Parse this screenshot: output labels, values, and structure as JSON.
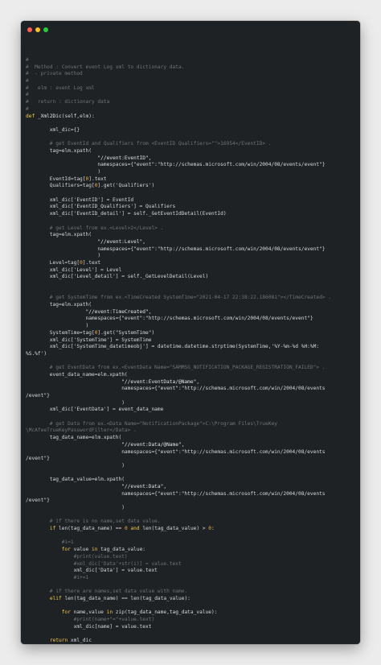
{
  "window": {
    "buttons": [
      {
        "name": "close",
        "color": "#ff5f56"
      },
      {
        "name": "minimize",
        "color": "#ffbd2e"
      },
      {
        "name": "zoom",
        "color": "#27c93f"
      }
    ]
  },
  "code": {
    "lines": [
      [
        [
          "c",
          "#"
        ]
      ],
      [
        [
          "c",
          "#  Method : Convert event Log xml to dictionary data."
        ]
      ],
      [
        [
          "c",
          "#  - private method"
        ]
      ],
      [
        [
          "c",
          "#"
        ]
      ],
      [
        [
          "c",
          "#   elm : event Log xml"
        ]
      ],
      [
        [
          "c",
          "#"
        ]
      ],
      [
        [
          "c",
          "#   return : dictionary data"
        ]
      ],
      [
        [
          "c",
          "#"
        ]
      ],
      [
        [
          "k",
          "def"
        ],
        [
          "p",
          " "
        ],
        [
          "f",
          "_Xml2Dic"
        ],
        [
          "p",
          "("
        ],
        [
          "p",
          "self"
        ],
        [
          "p",
          ",elm):"
        ]
      ],
      [
        [
          "p",
          ""
        ]
      ],
      [
        [
          "p",
          "        xml_dic={}"
        ]
      ],
      [
        [
          "p",
          ""
        ]
      ],
      [
        [
          "c",
          "        # get EventId and Qualifiers from <EventID Qualifiers=\"\">16954</EventID> ."
        ]
      ],
      [
        [
          "p",
          "        tag=elm.xpath("
        ]
      ],
      [
        [
          "s",
          "                        \"//event:EventID\","
        ]
      ],
      [
        [
          "p",
          "                        namespaces={\"event\":\"http://schemas.microsoft.com/win/2004/08/events/event\"}"
        ]
      ],
      [
        [
          "p",
          "                        )"
        ]
      ],
      [
        [
          "p",
          "        EventId=tag["
        ],
        [
          "n",
          "0"
        ],
        [
          "p",
          "].text"
        ]
      ],
      [
        [
          "p",
          "        Qualifiers=tag["
        ],
        [
          "n",
          "0"
        ],
        [
          "p",
          "].get('Qualifiers')"
        ]
      ],
      [
        [
          "p",
          ""
        ]
      ],
      [
        [
          "p",
          "        xml_dic['EventID'] = EventId"
        ]
      ],
      [
        [
          "p",
          "        xml_dic['EventID_Qualifiers'] = Qualifiers"
        ]
      ],
      [
        [
          "p",
          "        xml_dic['EventID_detail'] = self._GetEventIdDetail(EventId)"
        ]
      ],
      [
        [
          "p",
          ""
        ]
      ],
      [
        [
          "c",
          "        # get Level from ex.<Level>2</Level> ."
        ]
      ],
      [
        [
          "p",
          "        tag=elm.xpath("
        ]
      ],
      [
        [
          "s",
          "                        \"//event:Level\","
        ]
      ],
      [
        [
          "p",
          "                        namespaces={\"event\":\"http://schemas.microsoft.com/win/2004/08/events/event\"}"
        ]
      ],
      [
        [
          "p",
          "                        )"
        ]
      ],
      [
        [
          "p",
          "        Level=tag["
        ],
        [
          "n",
          "0"
        ],
        [
          "p",
          "].text"
        ]
      ],
      [
        [
          "p",
          "        xml_dic['Level'] = Level"
        ]
      ],
      [
        [
          "p",
          "        xml_dic['Level_detail'] = self._GetLevelDetail(Level)"
        ]
      ],
      [
        [
          "p",
          ""
        ]
      ],
      [
        [
          "p",
          ""
        ]
      ],
      [
        [
          "c",
          "        # get SystemTime from ex.<TimeCreated SystemTime=\"2021-04-17 22:38:22.186081\"></TimeCreated> ."
        ]
      ],
      [
        [
          "p",
          "        tag=elm.xpath("
        ]
      ],
      [
        [
          "s",
          "                    \"//event:TimeCreated\","
        ]
      ],
      [
        [
          "p",
          "                    namespaces={\"event\":\"http://schemas.microsoft.com/win/2004/08/events/event\"}"
        ]
      ],
      [
        [
          "p",
          "                    )"
        ]
      ],
      [
        [
          "p",
          "        SystemTime=tag["
        ],
        [
          "n",
          "0"
        ],
        [
          "p",
          "].get(\"SystemTime\")"
        ]
      ],
      [
        [
          "p",
          "        xml_dic['SystemTime'] = SystemTime"
        ]
      ],
      [
        [
          "p",
          "        xml_dic['SystemTime_datetimeobj'] = datetime.datetime.strptime(SystemTime,'%Y-%m-%d %H:%M:"
        ]
      ],
      [
        [
          "p",
          "%S.%f')"
        ]
      ],
      [
        [
          "p",
          ""
        ]
      ],
      [
        [
          "c",
          "        # get EventData from ex.<EventData Name=\"SAMMSG_NOTIFICATION_PACKAGE_REGISTRATION_FAILED\"> ."
        ]
      ],
      [
        [
          "p",
          "        event_data_name=elm.xpath("
        ]
      ],
      [
        [
          "s",
          "                                \"//event:EventData/@Name\","
        ]
      ],
      [
        [
          "p",
          "                                namespaces={\"event\":\"http://schemas.microsoft.com/win/2004/08/events"
        ]
      ],
      [
        [
          "p",
          "/event\"}"
        ]
      ],
      [
        [
          "p",
          "                                )"
        ]
      ],
      [
        [
          "p",
          "        xml_dic['EventData'] = event_data_name"
        ]
      ],
      [
        [
          "p",
          ""
        ]
      ],
      [
        [
          "c",
          "        # get Data from ex.<Data Name=\"NotificationPackage\">C:\\Program Files\\TrueKey"
        ]
      ],
      [
        [
          "c",
          "\\McAfeeTrueKeyPasswordFilter</Data> ."
        ]
      ],
      [
        [
          "p",
          "        tag_data_name=elm.xpath("
        ]
      ],
      [
        [
          "s",
          "                                \"//event:Data/@Name\","
        ]
      ],
      [
        [
          "p",
          "                                namespaces={\"event\":\"http://schemas.microsoft.com/win/2004/08/events"
        ]
      ],
      [
        [
          "p",
          "/event\"}"
        ]
      ],
      [
        [
          "p",
          "                                )"
        ]
      ],
      [
        [
          "p",
          ""
        ]
      ],
      [
        [
          "p",
          "        tag_data_value=elm.xpath("
        ]
      ],
      [
        [
          "s",
          "                                \"//event:Data\","
        ]
      ],
      [
        [
          "p",
          "                                namespaces={\"event\":\"http://schemas.microsoft.com/win/2004/08/events"
        ]
      ],
      [
        [
          "p",
          "/event\"}"
        ]
      ],
      [
        [
          "p",
          "                                )"
        ]
      ],
      [
        [
          "p",
          ""
        ]
      ],
      [
        [
          "c",
          "        # if there is no name,set data value."
        ]
      ],
      [
        [
          "p",
          "        "
        ],
        [
          "k",
          "if"
        ],
        [
          "p",
          " len(tag_data_name) == "
        ],
        [
          "n",
          "0"
        ],
        [
          "p",
          " "
        ],
        [
          "k",
          "and"
        ],
        [
          "p",
          " len(tag_data_value) > "
        ],
        [
          "n",
          "0"
        ],
        [
          "p",
          ":"
        ]
      ],
      [
        [
          "p",
          ""
        ]
      ],
      [
        [
          "c",
          "            #i=1"
        ]
      ],
      [
        [
          "p",
          "            "
        ],
        [
          "k",
          "for"
        ],
        [
          "p",
          " value "
        ],
        [
          "k",
          "in"
        ],
        [
          "p",
          " tag_data_value:"
        ]
      ],
      [
        [
          "c",
          "                #print(value.text)"
        ]
      ],
      [
        [
          "c",
          "                #xml_dic['Data'+str(i)] = value.text"
        ]
      ],
      [
        [
          "p",
          "                xml_dic['Data'] = value.text"
        ]
      ],
      [
        [
          "c",
          "                #i+=1"
        ]
      ],
      [
        [
          "p",
          ""
        ]
      ],
      [
        [
          "c",
          "        # if there are names,set data value with name."
        ]
      ],
      [
        [
          "p",
          "        "
        ],
        [
          "k",
          "elif"
        ],
        [
          "p",
          " len(tag_data_name) == len(tag_data_value):"
        ]
      ],
      [
        [
          "p",
          ""
        ]
      ],
      [
        [
          "p",
          "            "
        ],
        [
          "k",
          "for"
        ],
        [
          "p",
          " name,value "
        ],
        [
          "k",
          "in"
        ],
        [
          "p",
          " zip(tag_data_name,tag_data_value):"
        ]
      ],
      [
        [
          "c",
          "                #print(name+\"=\"+value.text)"
        ]
      ],
      [
        [
          "p",
          "                xml_dic[name] = value.text"
        ]
      ],
      [
        [
          "p",
          ""
        ]
      ],
      [
        [
          "p",
          "        "
        ],
        [
          "k",
          "return"
        ],
        [
          "p",
          " xml_dic"
        ]
      ]
    ]
  }
}
